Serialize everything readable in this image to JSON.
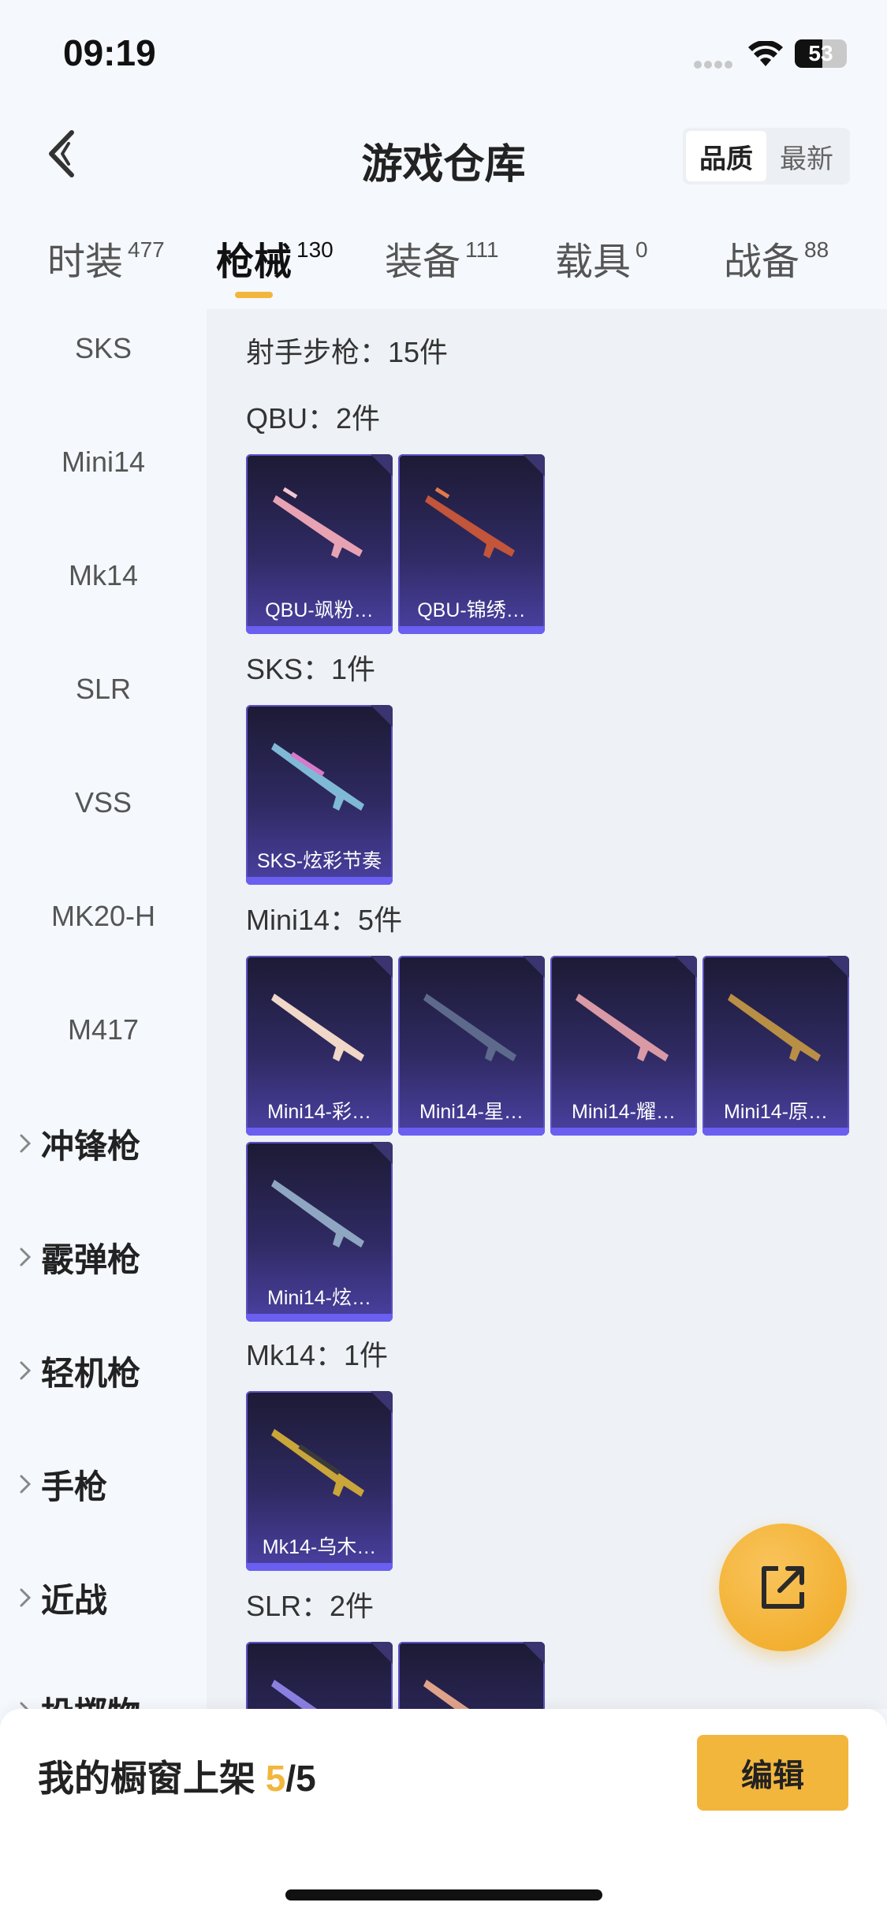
{
  "status_bar": {
    "time": "09:19",
    "battery": "53",
    "battery_level": 0.53
  },
  "header": {
    "title": "游戏仓库",
    "sort": [
      "品质",
      "最新"
    ],
    "sort_active": 0
  },
  "tabs": [
    {
      "label": "时装",
      "count": "477"
    },
    {
      "label": "枪械",
      "count": "130"
    },
    {
      "label": "装备",
      "count": "111"
    },
    {
      "label": "载具",
      "count": "0"
    },
    {
      "label": "战备",
      "count": "88"
    }
  ],
  "sidebar": {
    "items": [
      "SKS",
      "Mini14",
      "Mk14",
      "SLR",
      "VSS",
      "MK20-H",
      "M417"
    ],
    "groups": [
      "冲锋枪",
      "霰弹枪",
      "轻机枪",
      "手枪",
      "近战",
      "投掷物"
    ]
  },
  "main": {
    "category_summary": "射手步枪：15件",
    "sections": [
      {
        "title": "QBU：2件",
        "items": [
          "QBU-飒粉…",
          "QBU-锦绣…"
        ]
      },
      {
        "title": "SKS：1件",
        "items": [
          "SKS-炫彩节奏"
        ]
      },
      {
        "title": "Mini14：5件",
        "items": [
          "Mini14-彩…",
          "Mini14-星…",
          "Mini14-耀…",
          "Mini14-原…",
          "Mini14-炫…"
        ]
      },
      {
        "title": "Mk14：1件",
        "items": [
          "Mk14-乌木…"
        ]
      },
      {
        "title": "SLR：2件",
        "items": [
          "",
          ""
        ]
      }
    ]
  },
  "bottom": {
    "shelf_label": "我的橱窗上架",
    "shelf_count": "5",
    "shelf_total": "/5",
    "edit_label": "编辑"
  },
  "colors": {
    "accent": "#f2b63d",
    "card_top": "#1c1a34",
    "card_bottom": "#4a41a2",
    "card_strip": "#6a5ff0"
  },
  "icons": {
    "back": "chevron-left-icon",
    "share": "share-icon",
    "group": "chevron-right-icon"
  }
}
